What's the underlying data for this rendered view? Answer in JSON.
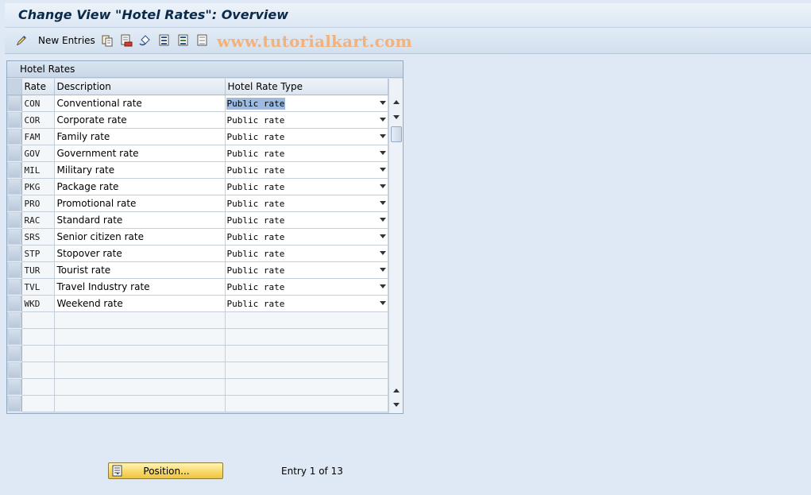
{
  "window": {
    "title": "Change View \"Hotel Rates\": Overview"
  },
  "toolbar": {
    "new_entries_label": "New Entries",
    "icons": [
      "edit-pencil-icon",
      "copy-icon",
      "delete-icon",
      "undo-change-icon",
      "select-all-icon",
      "select-block-icon",
      "deselect-all-icon"
    ],
    "watermark": "www.tutorialkart.com"
  },
  "table": {
    "title": "Hotel Rates",
    "columns": {
      "rate": "Rate",
      "description": "Description",
      "type": "Hotel Rate Type"
    },
    "rows": [
      {
        "rate": "CON",
        "description": "Conventional rate",
        "type": "Public rate"
      },
      {
        "rate": "COR",
        "description": "Corporate rate",
        "type": "Public rate"
      },
      {
        "rate": "FAM",
        "description": "Family rate",
        "type": "Public rate"
      },
      {
        "rate": "GOV",
        "description": "Government rate",
        "type": "Public rate"
      },
      {
        "rate": "MIL",
        "description": "Military rate",
        "type": "Public rate"
      },
      {
        "rate": "PKG",
        "description": "Package rate",
        "type": "Public rate"
      },
      {
        "rate": "PRO",
        "description": "Promotional rate",
        "type": "Public rate"
      },
      {
        "rate": "RAC",
        "description": "Standard rate",
        "type": "Public rate"
      },
      {
        "rate": "SRS",
        "description": "Senior citizen rate",
        "type": "Public rate"
      },
      {
        "rate": "STP",
        "description": "Stopover rate",
        "type": "Public rate"
      },
      {
        "rate": "TUR",
        "description": "Tourist rate",
        "type": "Public rate"
      },
      {
        "rate": "TVL",
        "description": "Travel Industry rate",
        "type": "Public rate"
      },
      {
        "rate": "WKD",
        "description": "Weekend rate",
        "type": "Public rate"
      }
    ],
    "empty_rows": 6
  },
  "footer": {
    "position_button": "Position...",
    "entry_info": "Entry 1 of 13"
  },
  "colors": {
    "button_yellow": "#f7d96a",
    "selection_highlight": "#9dbbe0",
    "background": "#dfe9f5"
  }
}
